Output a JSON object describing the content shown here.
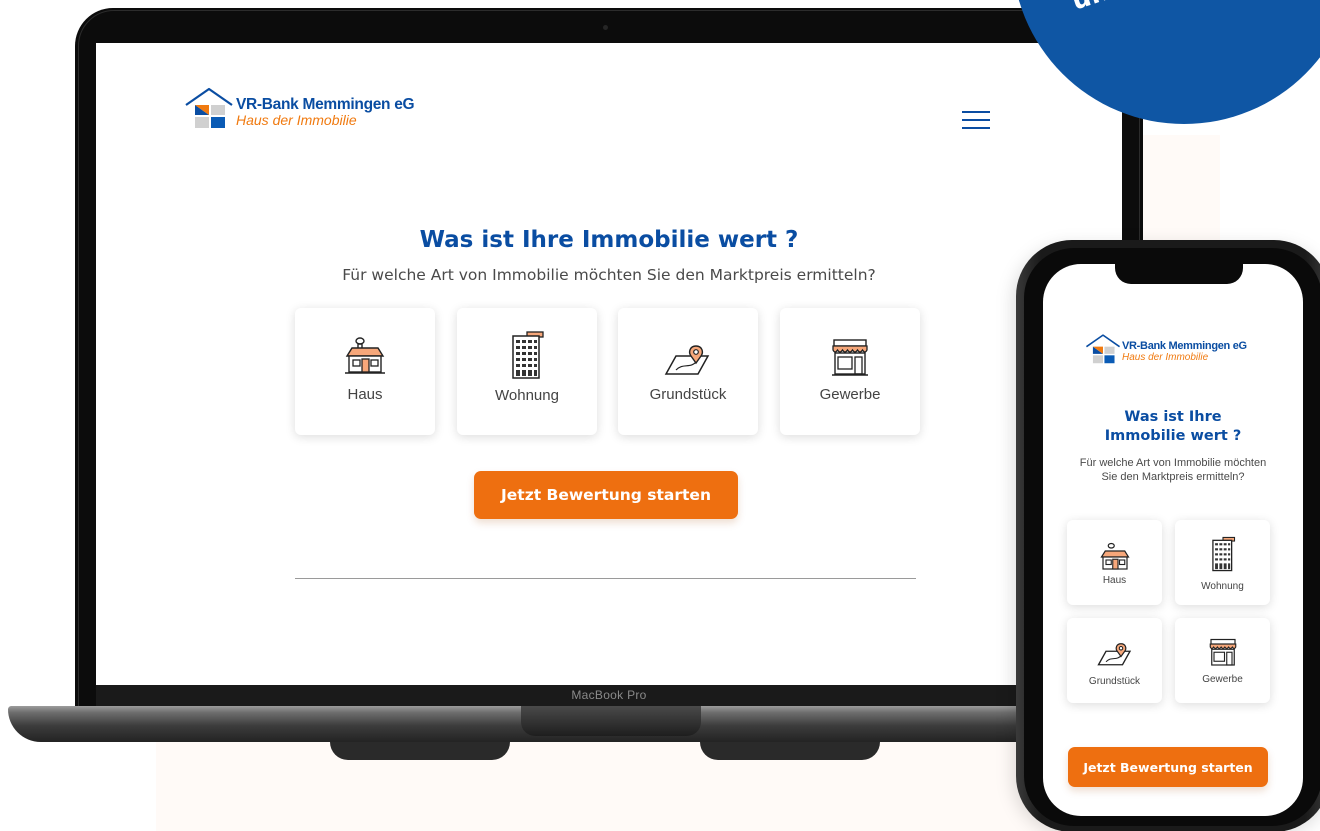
{
  "colors": {
    "brand_blue": "#0a4da2",
    "brand_orange": "#ee6f10",
    "badge_blue": "#0f56a4"
  },
  "badge": {
    "text": "unver"
  },
  "laptop": {
    "model_label": "MacBook Pro"
  },
  "site": {
    "logo": {
      "bank_name": "VR-Bank Memmingen eG",
      "subtitle": "Haus der Immobilie"
    },
    "menu_icon": "hamburger-menu-icon",
    "heading": "Was ist Ihre Immobilie wert ?",
    "subheading": "Für welche Art von Immobilie möchten Sie den Marktpreis ermitteln?",
    "property_types": [
      {
        "label": "Haus",
        "icon": "house-icon"
      },
      {
        "label": "Wohnung",
        "icon": "apartment-building-icon"
      },
      {
        "label": "Grundstück",
        "icon": "land-plot-icon"
      },
      {
        "label": "Gewerbe",
        "icon": "storefront-icon"
      }
    ],
    "cta_label": "Jetzt Bewertung starten"
  },
  "mobile": {
    "logo": {
      "bank_name": "VR-Bank Memmingen eG",
      "subtitle": "Haus der Immobilie"
    },
    "heading_line1": "Was ist Ihre",
    "heading_line2": "Immobilie wert ?",
    "subheading_line1": "Für welche Art von Immobilie möchten",
    "subheading_line2": "Sie den Marktpreis ermitteln?",
    "property_types": [
      {
        "label": "Haus",
        "icon": "house-icon"
      },
      {
        "label": "Wohnung",
        "icon": "apartment-building-icon"
      },
      {
        "label": "Grundstück",
        "icon": "land-plot-icon"
      },
      {
        "label": "Gewerbe",
        "icon": "storefront-icon"
      }
    ],
    "cta_label": "Jetzt Bewertung starten"
  }
}
